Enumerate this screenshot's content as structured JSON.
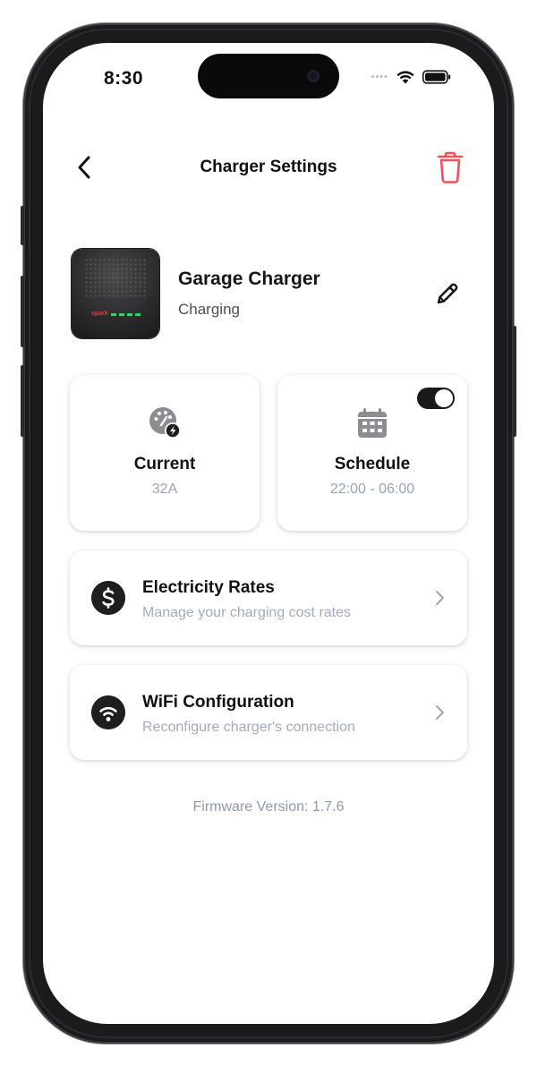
{
  "status_bar": {
    "time": "8:30",
    "signal_dots": "••••"
  },
  "header": {
    "title": "Charger Settings"
  },
  "device": {
    "name": "Garage Charger",
    "status": "Charging",
    "brand_text": "spark"
  },
  "tiles": {
    "current": {
      "title": "Current",
      "value": "32A"
    },
    "schedule": {
      "title": "Schedule",
      "value": "22:00 - 06:00",
      "enabled": true
    }
  },
  "rows": {
    "electricity": {
      "title": "Electricity Rates",
      "subtitle": "Manage your charging cost rates"
    },
    "wifi": {
      "title": "WiFi Configuration",
      "subtitle": "Reconfigure charger's connection"
    }
  },
  "firmware": "Firmware Version: 1.7.6",
  "colors": {
    "delete": "#f0505c",
    "tile_icon": "#8d8d91",
    "dark": "#1f1f1f",
    "muted_text": "#9aa3b5"
  }
}
